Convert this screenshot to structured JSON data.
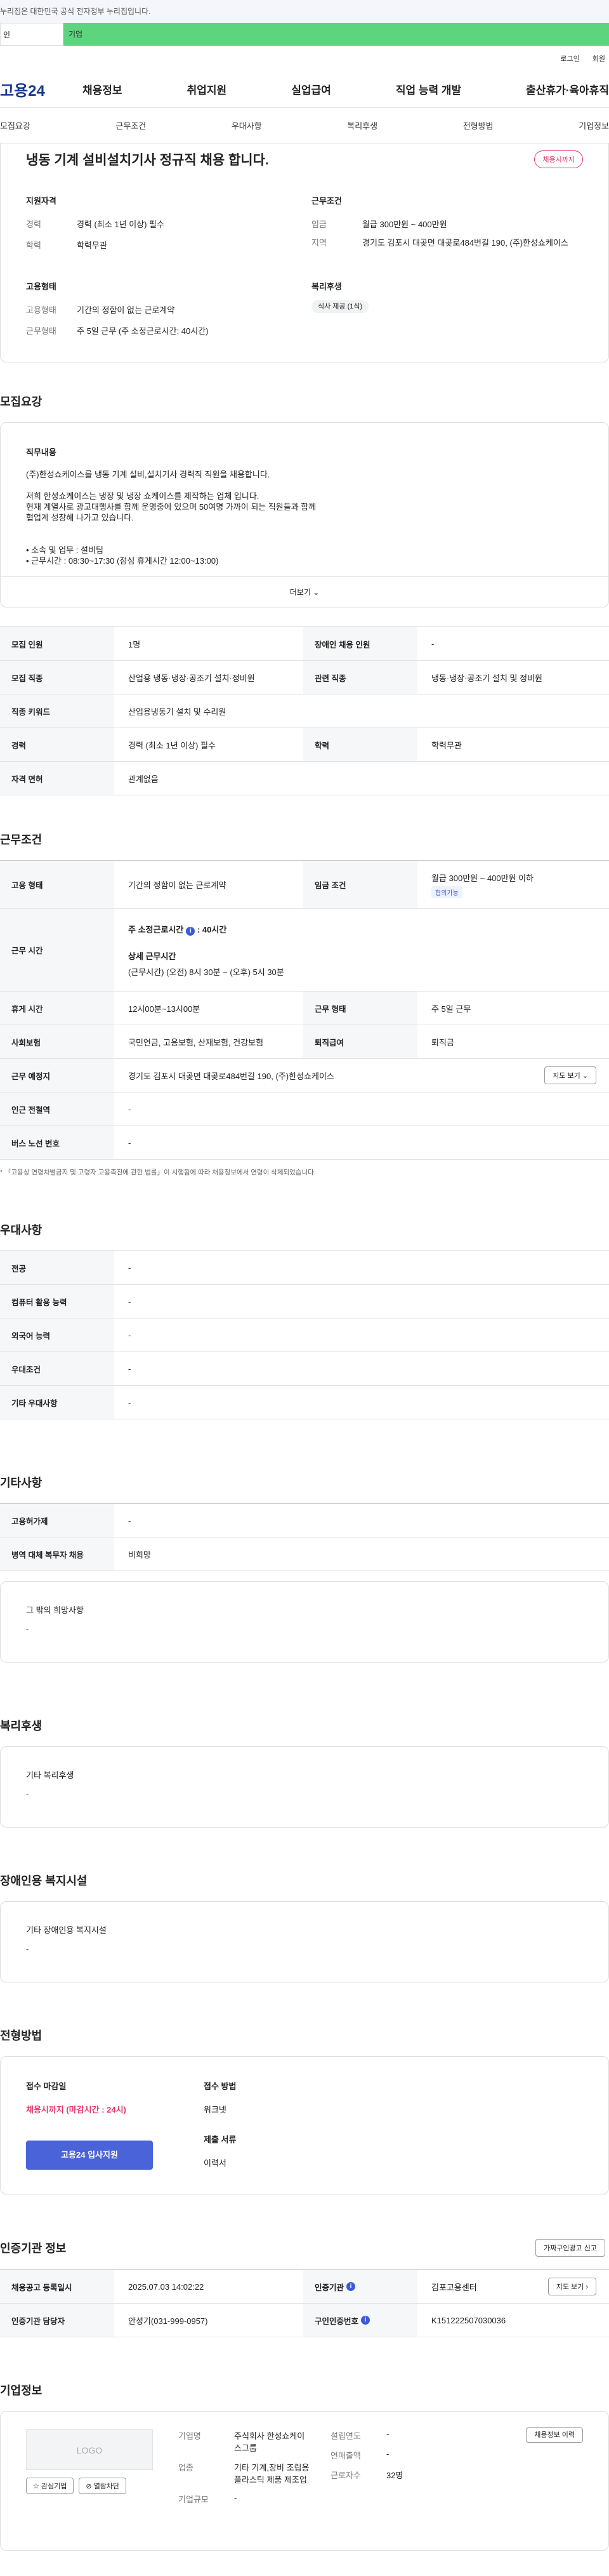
{
  "topbar": {
    "notice": "누리집은 대한민국 공식 전자정부 누리집입니다."
  },
  "gnb": {
    "left": "인",
    "right": "기업"
  },
  "util": {
    "login": "로그인",
    "join": "회원"
  },
  "header": {
    "logo": "고용24",
    "menu": [
      "채용정보",
      "취업지원",
      "실업급여",
      "직업 능력 개발",
      "출산휴가·육아휴직"
    ]
  },
  "subnav": [
    "모집요강",
    "근무조건",
    "우대사항",
    "복리후생",
    "전형방법",
    "기업정보"
  ],
  "summary": {
    "title": "냉동 기계 설비설치기사 정규직 채용 합니다.",
    "badge": "채용시까지",
    "qual_title": "지원자격",
    "career_label": "경력",
    "career": "경력 (최소 1년 이상) 필수",
    "edu_label": "학력",
    "edu": "학력무관",
    "cond_title": "근무조건",
    "wage_label": "임금",
    "wage": "월급 300만원 ~ 400만원",
    "area_label": "지역",
    "area": "경기도 김포시 대곶면 대곶로484번길 190, (주)한성쇼케이스",
    "emp_title": "고용형태",
    "emptype_label": "고용형태",
    "emptype": "기간의 정함이 없는 근로계약",
    "worktype_label": "근무형태",
    "worktype": "주 5일 근무 (주 소정근로시간: 40시간)",
    "welfare_title": "복리후생",
    "welfare_tag": "식사 제공 (1식)"
  },
  "recruit": {
    "title": "모집요강",
    "job_title": "직무내용",
    "job_lines": [
      "(주)한성쇼케이스를 냉동 기계 설비,설치기사 경력직 직원을 채용합니다.",
      "",
      "저희 한성쇼케이스는 냉장 및 냉장 쇼케이스를 제작하는 업체 입니다.",
      "현재 계열사로 광고대행사를 함께 운영중에 있으며 50여명 가까이 되는 직원들과 함께",
      "협업계 성장해 나가고 있습니다.",
      "",
      "",
      "• 소속 및 업무 : 설비팀",
      "• 근무시간 : 08:30~17:30 (점심 휴게시간 12:00~13:00)"
    ],
    "more": "더보기 ⌄",
    "rows": [
      {
        "th": "모집 인원",
        "td": "1명",
        "th2": "장애인 채용 인원",
        "td2": "-"
      },
      {
        "th": "모집 직종",
        "td": "산업용 냉동·냉장·공조기 설치·정비원",
        "th2": "관련 직종",
        "td2": "냉동·냉장·공조기 설치 및 정비원"
      },
      {
        "th": "직종 키워드",
        "td": "산업용냉동기 설치 및 수리원"
      },
      {
        "th": "경력",
        "td": "경력 (최소 1년 이상) 필수",
        "th2": "학력",
        "td2": "학력무관"
      },
      {
        "th": "자격 면허",
        "td": "관계없음"
      }
    ]
  },
  "work": {
    "title": "근무조건",
    "emp_th": "고용 형태",
    "emp_td": "기간의 정함이 없는 근로계약",
    "wage_th": "임금 조건",
    "wage_td": "월급 300만원 ~ 400만원 이하",
    "wage_badge": "협의가능",
    "time_th": "근무 시간",
    "time_main": "주 소정근로시간",
    "time_hours": "40시간",
    "time_detail_title": "상세 근무시간",
    "time_detail": "(근무시간) (오전) 8시 30분 ~ (오후) 5시 30분",
    "rest_th": "휴게 시간",
    "rest_td": "12시00분~13시00분",
    "form_th": "근무 형태",
    "form_td": "주 5일 근무",
    "ins_th": "사회보험",
    "ins_td": "국민연금, 고용보험, 산재보험, 건강보험",
    "ret_th": "퇴직급여",
    "ret_td": "퇴직금",
    "place_th": "근무 예정지",
    "place_td": "경기도 김포시 대곶면 대곶로484번길 190, (주)한성쇼케이스",
    "map_btn": "지도 보기 ⌄",
    "subway_th": "인근 전철역",
    "subway_td": "-",
    "bus_th": "버스 노선 번호",
    "bus_td": "-",
    "note": "* 「고용상 연령차별금지 및 고령자 고용촉진에 관한 법률」이 시행됨에 따라 채용정보에서 연령이 삭제되었습니다."
  },
  "prefer": {
    "title": "우대사항",
    "rows": [
      {
        "th": "전공",
        "td": "-"
      },
      {
        "th": "컴퓨터 활용 능력",
        "td": "-"
      },
      {
        "th": "외국어 능력",
        "td": "-"
      },
      {
        "th": "우대조건",
        "td": "-"
      },
      {
        "th": "기타 우대사항",
        "td": "-"
      }
    ]
  },
  "etc": {
    "title": "기타사항",
    "rows": [
      {
        "th": "고용허가제",
        "td": "-"
      },
      {
        "th": "병역 대체 복무자 채용",
        "td": "비희망"
      }
    ],
    "box_title": "그 밖의 희망사항",
    "box_value": "-"
  },
  "welfare": {
    "title": "복리후생",
    "box_title": "기타 복리후생",
    "box_value": "-"
  },
  "disabled": {
    "title": "장애인용 복지시설",
    "box_title": "기타 장애인용 복지시설",
    "box_value": "-"
  },
  "process": {
    "title": "전형방법",
    "deadline_title": "접수 마감일",
    "deadline": "채용시까지 (마감시간 : 24시)",
    "apply_btn": "고용24 입사지원",
    "method_title": "접수 방법",
    "method": "워크넷",
    "docs_title": "제출 서류",
    "docs": "이력서"
  },
  "cert": {
    "title": "인증기관 정보",
    "report_btn": "가짜구인광고 신고",
    "reg_th": "채용공고 등록일시",
    "reg_td": "2025.07.03 14:02:22",
    "org_th": "인증기관",
    "org_td": "김포고용센터",
    "map_btn": "지도 보기 ›",
    "mgr_th": "인증기관 담당자",
    "mgr_td": "안성기(031-999-0957)",
    "no_th": "구인인증번호",
    "no_td": "K151222507030036"
  },
  "company": {
    "title": "기업정보",
    "logo": "LOGO",
    "fav_btn": "관심기업",
    "block_btn": "열람차단",
    "name_label": "기업명",
    "name": "주식회사 한성쇼케이스그룹",
    "ind_label": "업종",
    "ind": "기타 기계,장비 조립용 플라스틱 제품 제조업",
    "size_label": "기업규모",
    "size": "-",
    "year_label": "설립연도",
    "year": "-",
    "sales_label": "연매출액",
    "sales": "-",
    "emp_label": "근로자수",
    "emp": "32명",
    "job_btn": "채용정보 이력"
  }
}
